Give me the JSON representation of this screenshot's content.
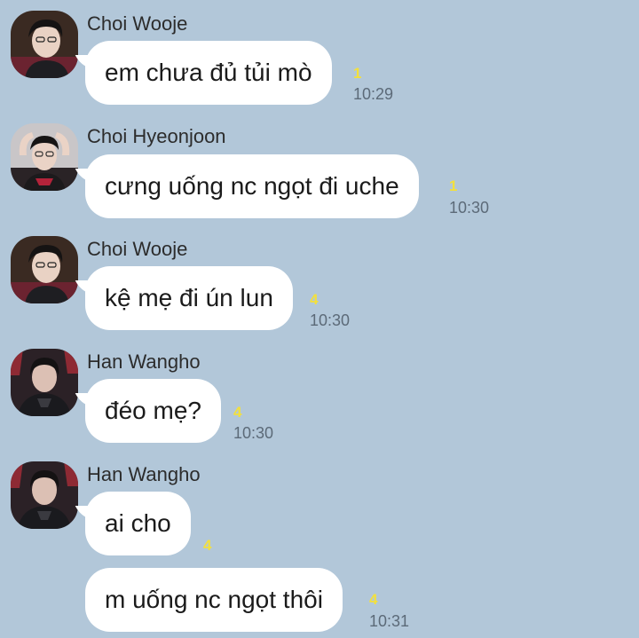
{
  "messages": [
    {
      "sender": "Choi Wooje",
      "avatar_icon": "profile-photo-woojae",
      "bubbles": [
        {
          "text": "em chưa đủ tủi mò",
          "unread": "1",
          "time": "10:29"
        }
      ]
    },
    {
      "sender": "Choi Hyeonjoon",
      "avatar_icon": "profile-photo-hyeonjoon",
      "bubbles": [
        {
          "text": "cưng uống nc ngọt đi uche",
          "unread": "1",
          "time": "10:30"
        }
      ]
    },
    {
      "sender": "Choi Wooje",
      "avatar_icon": "profile-photo-woojae",
      "bubbles": [
        {
          "text": "kệ mẹ đi ún lun",
          "unread": "4",
          "time": "10:30"
        }
      ]
    },
    {
      "sender": "Han Wangho",
      "avatar_icon": "profile-photo-wangho",
      "bubbles": [
        {
          "text": "đéo mẹ?",
          "unread": "4",
          "time": "10:30"
        }
      ]
    },
    {
      "sender": "Han Wangho",
      "avatar_icon": "profile-photo-wangho",
      "bubbles": [
        {
          "text": "ai cho",
          "unread": "4",
          "time": ""
        },
        {
          "text": "m uống nc ngọt thôi",
          "unread": "4",
          "time": "10:31"
        }
      ]
    }
  ],
  "colors": {
    "background": "#b2c7d9",
    "bubble": "#ffffff",
    "unread": "#f3e03c",
    "time": "#5c6a78"
  }
}
